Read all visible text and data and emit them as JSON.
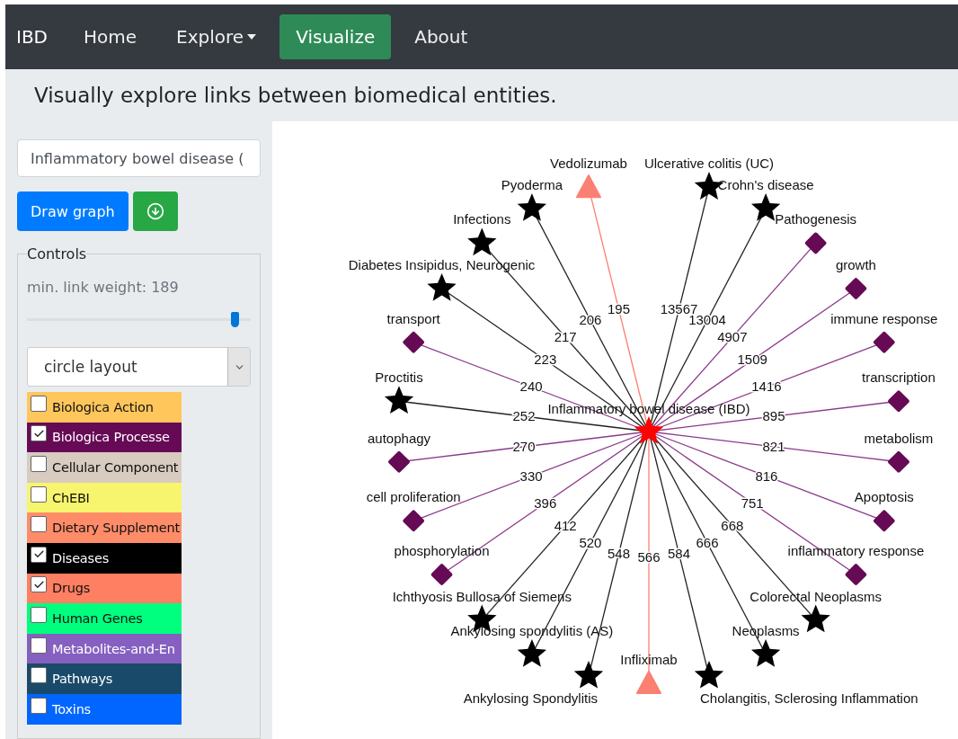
{
  "navbar": {
    "brand": "IBD",
    "items": [
      {
        "label": "Home",
        "kind": "link",
        "selected": false
      },
      {
        "label": "Explore",
        "kind": "dropdown",
        "selected": false
      },
      {
        "label": "Visualize",
        "kind": "link",
        "selected": true
      },
      {
        "label": "About",
        "kind": "link",
        "selected": false
      }
    ]
  },
  "subtitle": "Visually explore links between biomedical entities.",
  "sidebar": {
    "search": {
      "value": "Inflammatory bowel disease ("
    },
    "draw_button": "Draw graph",
    "controls": {
      "legend": "Controls",
      "weight_label": "min. link weight: 189",
      "slider": {
        "level": 0.93
      },
      "layout_select": "circle layout",
      "categories": [
        {
          "label": "Biologica Action",
          "checked": false,
          "color": "#ffc65c"
        },
        {
          "label": "Biologica Processe",
          "checked": true,
          "color": "#660a55"
        },
        {
          "label": "Cellular Component",
          "checked": false,
          "color": "#d8cbbf"
        },
        {
          "label": "ChEBI",
          "checked": false,
          "color": "#f7f56d"
        },
        {
          "label": "Dietary Supplement",
          "checked": false,
          "color": "#ff8c69"
        },
        {
          "label": "Diseases",
          "checked": true,
          "color": "#000000"
        },
        {
          "label": "Drugs",
          "checked": true,
          "color": "#ff7f62"
        },
        {
          "label": "Human Genes",
          "checked": false,
          "color": "#00ff7f"
        },
        {
          "label": "Metabolites-and-En",
          "checked": false,
          "color": "#8660c0"
        },
        {
          "label": "Pathways",
          "checked": false,
          "color": "#1a4a6a"
        },
        {
          "label": "Toxins",
          "checked": false,
          "color": "#0066ff"
        }
      ]
    }
  },
  "graph": {
    "center": "Inflammatory bowel disease (IBD)",
    "left_nodes": [
      {
        "label": "Vedolizumab",
        "kind": "drug",
        "weight": "195"
      },
      {
        "label": "Pyoderma",
        "kind": "disease",
        "weight": "206"
      },
      {
        "label": "Infections",
        "kind": "disease",
        "weight": "217"
      },
      {
        "label": "Diabetes Insipidus, Neurogenic",
        "kind": "disease",
        "weight": "223"
      },
      {
        "label": "transport",
        "kind": "process",
        "weight": "240"
      },
      {
        "label": "Proctitis",
        "kind": "disease",
        "weight": "252"
      },
      {
        "label": "autophagy",
        "kind": "process",
        "weight": "270"
      },
      {
        "label": "cell proliferation",
        "kind": "process",
        "weight": "330"
      },
      {
        "label": "phosphorylation",
        "kind": "process",
        "weight": "396"
      },
      {
        "label": "Ichthyosis Bullosa of Siemens",
        "kind": "disease",
        "weight": "412"
      },
      {
        "label": "Ankylosing spondylitis (AS)",
        "kind": "disease",
        "weight": "520"
      },
      {
        "label": "Ankylosing Spondylitis",
        "kind": "disease",
        "weight": "548"
      }
    ],
    "right_nodes": [
      {
        "label": "Ulcerative colitis (UC)",
        "kind": "disease",
        "weight": "13567"
      },
      {
        "label": "Crohn's disease",
        "kind": "disease",
        "weight": "13004"
      },
      {
        "label": "Pathogenesis",
        "kind": "process",
        "weight": "4907"
      },
      {
        "label": "growth",
        "kind": "process",
        "weight": "1509"
      },
      {
        "label": "immune response",
        "kind": "process",
        "weight": "1416"
      },
      {
        "label": "transcription",
        "kind": "process",
        "weight": "895"
      },
      {
        "label": "metabolism",
        "kind": "process",
        "weight": "821"
      },
      {
        "label": "Apoptosis",
        "kind": "process",
        "weight": "816"
      },
      {
        "label": "inflammatory response",
        "kind": "process",
        "weight": "751"
      },
      {
        "label": "Colorectal Neoplasms",
        "kind": "disease",
        "weight": "668"
      },
      {
        "label": "Neoplasms",
        "kind": "disease",
        "weight": "666"
      },
      {
        "label": "Cholangitis, Sclerosing Inflammation",
        "kind": "disease",
        "weight": "584"
      },
      {
        "label": "Infliximab",
        "kind": "drug",
        "weight": "566"
      }
    ]
  }
}
